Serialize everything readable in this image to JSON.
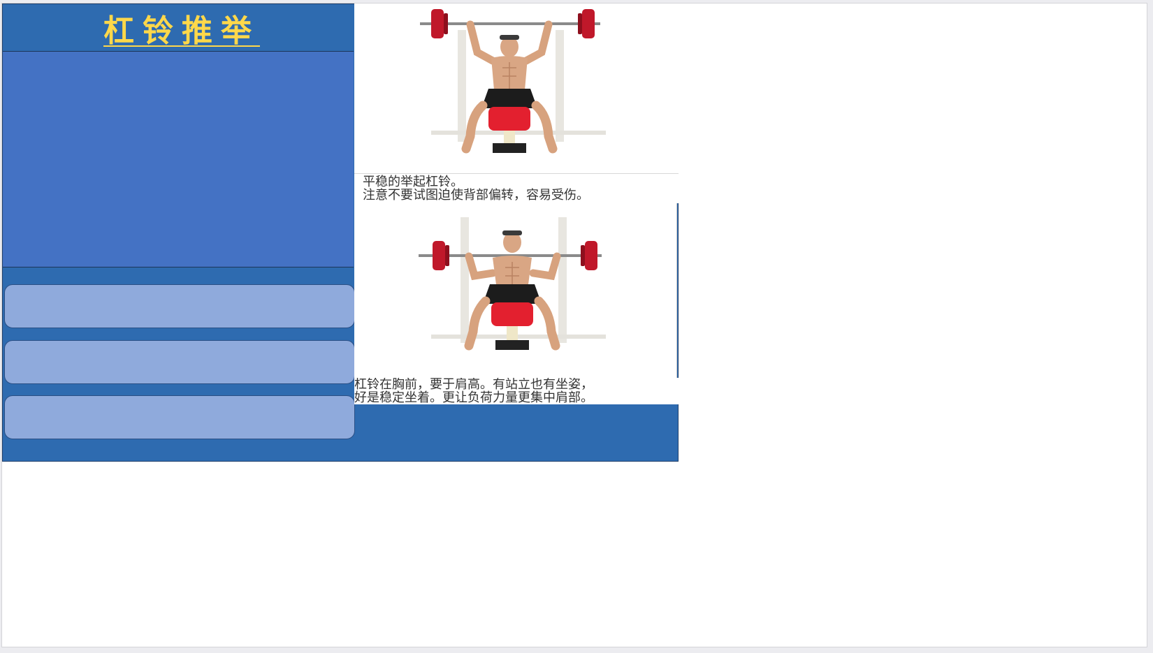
{
  "slide": {
    "title": "杠铃推举",
    "captions": {
      "top": [
        "平稳的举起杠铃。",
        "注意不要试图迫使背部偏转，容易受伤。"
      ],
      "bottom": [
        "杠铃在胸前，要于肩高。有站立也有坐姿，",
        "好是稳定坐着。更让负荷力量更集中肩部。"
      ]
    },
    "options": [
      "",
      "",
      ""
    ]
  },
  "colors": {
    "panel": "#2e6bb0",
    "content_box": "#4472c4",
    "option_fill": "#8faadc",
    "title_text": "#ffd84a",
    "plate_red": "#c0182a",
    "seat_red": "#e3202f"
  },
  "images": {
    "top": "seated-barbell-press-arms-extended",
    "bottom": "seated-barbell-press-bar-at-shoulders"
  }
}
